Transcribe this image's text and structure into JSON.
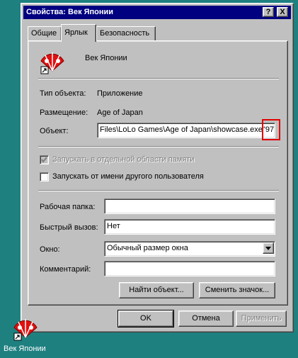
{
  "window": {
    "title": "Свойства: Век Японии",
    "help_button": "?",
    "close_button": "X"
  },
  "tabs": [
    {
      "label": "Общие"
    },
    {
      "label": "Ярлык"
    },
    {
      "label": "Безопасность"
    }
  ],
  "shortcut": {
    "name": "Век Японии",
    "type_label": "Тип объекта:",
    "type_value": "Приложение",
    "location_label": "Размещение:",
    "location_value": "Age of Japan",
    "target_label": "Объект:",
    "target_value": "Files\\LoLo Games\\Age of Japan\\showcase.exe\"",
    "target_extra": "97"
  },
  "options": {
    "separate_memory": "Запускать в отдельной области памяти",
    "run_as_other": "Запускать от имени другого пользователя"
  },
  "fields": {
    "working_dir_label": "Рабочая папка:",
    "working_dir_value": "",
    "hotkey_label": "Быстрый вызов:",
    "hotkey_value": "Нет",
    "window_label": "Окно:",
    "window_value": "Обычный размер окна",
    "comment_label": "Комментарий:",
    "comment_value": ""
  },
  "buttons": {
    "find_target": "Найти объект...",
    "change_icon": "Сменить значок...",
    "ok": "OK",
    "cancel": "Отмена",
    "apply": "Применить"
  },
  "desktop": {
    "icon_label": "Век Японии"
  }
}
